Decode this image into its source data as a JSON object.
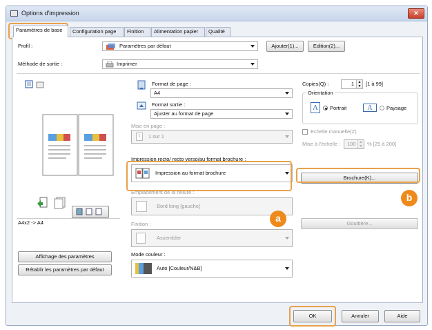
{
  "window": {
    "title": "Options d'impression",
    "close": "✕"
  },
  "tabs": [
    "Paramètres de base",
    "Configuration page",
    "Finition",
    "Alimentation papier",
    "Qualité"
  ],
  "profile": {
    "label": "Profil :",
    "value": "Paramètres par défaut",
    "add": "Ajouter(1)...",
    "edit": "Edition(2)..."
  },
  "output": {
    "label": "Méthode de sortie :",
    "value": "Imprimer"
  },
  "preview": {
    "caption": "A4x2 -> A4",
    "show_settings": "Affichage des paramètres",
    "restore_defaults": "Rétablir les paramètres par défaut"
  },
  "page_size": {
    "label": "Format de page :",
    "value": "A4"
  },
  "output_size": {
    "label": "Format sortie :",
    "value": "Ajuster au format de page"
  },
  "layout": {
    "label": "Mise en page :",
    "value": "1 sur 1"
  },
  "duplex": {
    "label": "Impression recto/ recto verso/au format brochure :",
    "value": "Impression au format brochure"
  },
  "binding": {
    "label": "Emplacement de la reliure :",
    "value": "Bord long [gauche]"
  },
  "finishing": {
    "label": "Finition :",
    "value": "Assembler"
  },
  "color": {
    "label": "Mode couleur :",
    "value": "Auto [Couleur/N&B]"
  },
  "copies": {
    "label": "Copies(Q) :",
    "value": "1",
    "range": "[1 à 99]"
  },
  "orientation": {
    "label": "Orientation",
    "portrait": "Portrait",
    "landscape": "Paysage",
    "glyph": "A"
  },
  "scaling": {
    "label": "Echelle manuelle(Z)",
    "scale_label": "Mise à l'échelle :",
    "value": "100",
    "range": "% [25 à 200]"
  },
  "booklet_button": "Brochure(K)...",
  "gutter_button": "Gouttière...",
  "badges": {
    "a": "a",
    "b": "b"
  },
  "footer": {
    "ok": "OK",
    "cancel": "Annuler",
    "help": "Aide"
  }
}
